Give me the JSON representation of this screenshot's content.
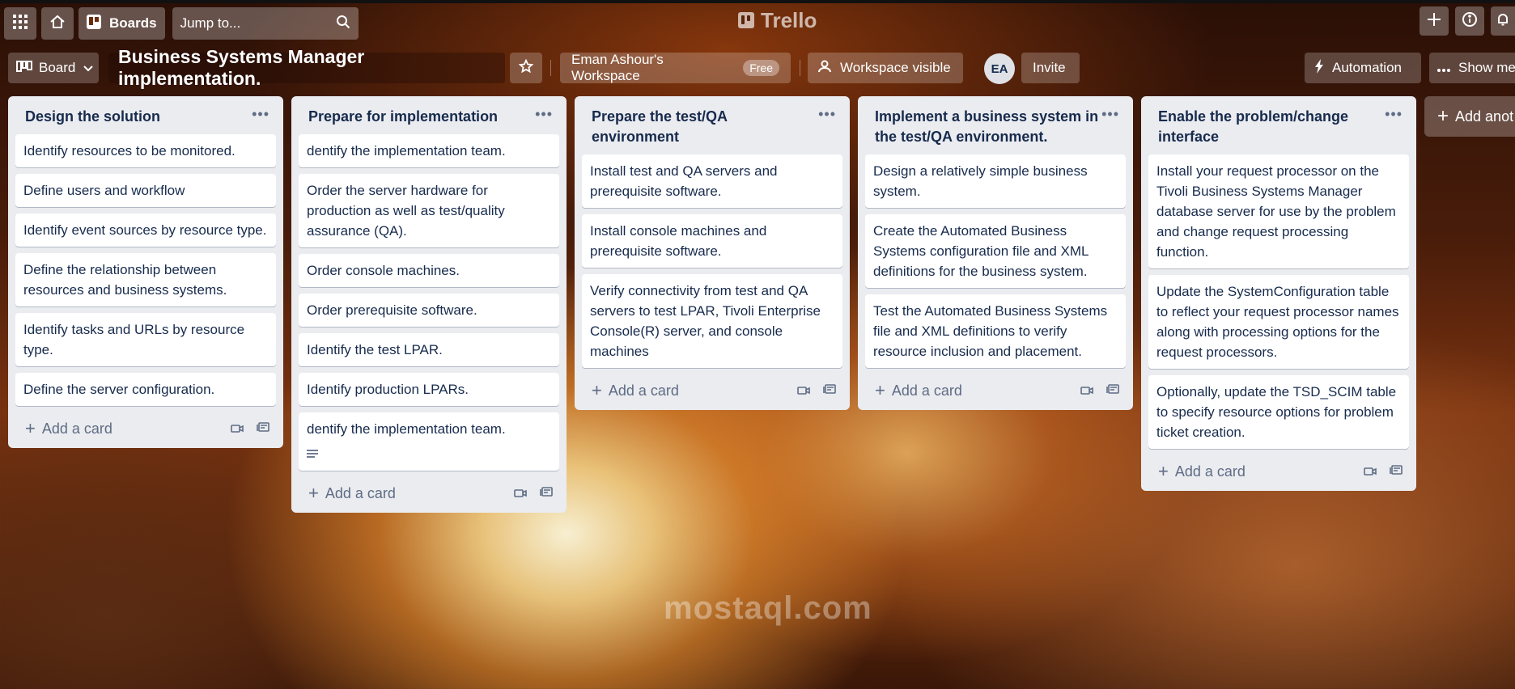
{
  "app": {
    "logo_text": "Trello"
  },
  "header": {
    "boards_label": "Boards",
    "search_placeholder": "Jump to..."
  },
  "board": {
    "view_label": "Board",
    "title": "Business Systems Manager implementation.",
    "workspace": "Eman Ashour's Workspace",
    "plan_badge": "Free",
    "visibility": "Workspace visible",
    "member_initials": "EA",
    "invite_label": "Invite",
    "automation_label": "Automation",
    "show_menu_label": "Show me"
  },
  "lists": [
    {
      "title": "Design the solution",
      "cards": [
        "Identify resources to be monitored.",
        "Define users and workflow",
        "Identify event sources by resource type.",
        "Define the relationship between resources and business systems.",
        "Identify tasks and URLs by resource type.",
        "Define the server configuration."
      ],
      "add_label": "Add a card"
    },
    {
      "title": "Prepare for implementation",
      "cards": [
        "dentify the implementation team.",
        "Order the server hardware for production as well as test/quality assurance (QA).",
        "Order console machines.",
        "Order prerequisite software.",
        "Identify the test LPAR.",
        "Identify production LPARs.",
        "dentify the implementation team."
      ],
      "add_label": "Add a card"
    },
    {
      "title": "Prepare the test/QA environment",
      "cards": [
        "Install test and QA servers and prerequisite software.",
        "Install console machines and prerequisite software.",
        "Verify connectivity from test and QA servers to test LPAR, Tivoli Enterprise Console(R) server, and console machines"
      ],
      "add_label": "Add a card"
    },
    {
      "title": "Implement a business system in the test/QA environment.",
      "cards": [
        "Design a relatively simple business system.",
        "Create the Automated Business Systems configuration file and XML definitions for the business system.",
        "Test the Automated Business Systems file and XML definitions to verify resource inclusion and placement."
      ],
      "add_label": "Add a card"
    },
    {
      "title": "Enable the problem/change interface",
      "cards": [
        "Install your request processor on the Tivoli Business Systems Manager database server for use by the problem and change request processing function.",
        "Update the SystemConfiguration table to reflect your request processor names along with processing options for the request processors.",
        "Optionally, update the TSD_SCIM table to specify resource options for problem ticket creation."
      ],
      "add_label": "Add a card"
    }
  ],
  "add_list_label": "Add anot",
  "watermark": "mostaql.com",
  "colors": {
    "list_bg": "#ebecf0",
    "text": "#172b4d",
    "muted": "#5e6c84"
  }
}
